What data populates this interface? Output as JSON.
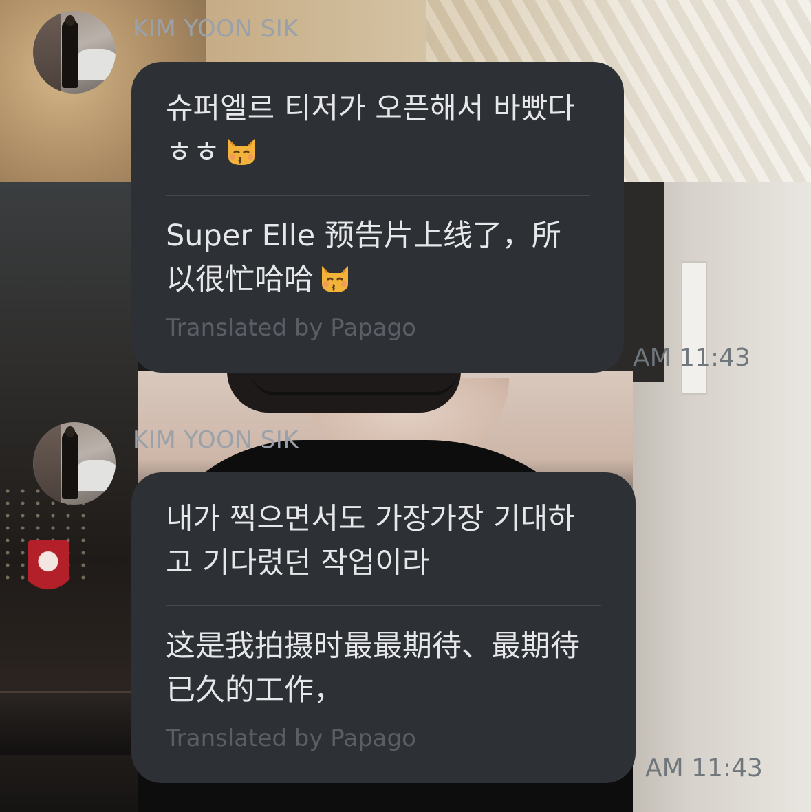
{
  "messages": [
    {
      "sender": "KIM YOON SIK",
      "original": "슈퍼엘르 티저가 오픈해서 바빴다 ㅎㅎ",
      "translation": "Super Elle 预告片上线了，所以很忙哈哈",
      "translated_by": "Translated by Papago",
      "time": "AM 11:43",
      "emoji": "kissing-cat-icon"
    },
    {
      "sender": "KIM YOON SIK",
      "original": "내가 찍으면서도 가장가장 기대하고 기다렸던 작업이라",
      "translation": "这是我拍摄时最最期待、最期待已久的工作，",
      "translated_by": "Translated by Papago",
      "time": "AM 11:43"
    }
  ],
  "colors": {
    "bubble": "#2d3035",
    "text": "#e6e7e9",
    "sender": "#9aa1a8",
    "papago": "#5a5f66",
    "time": "#6f767c"
  }
}
